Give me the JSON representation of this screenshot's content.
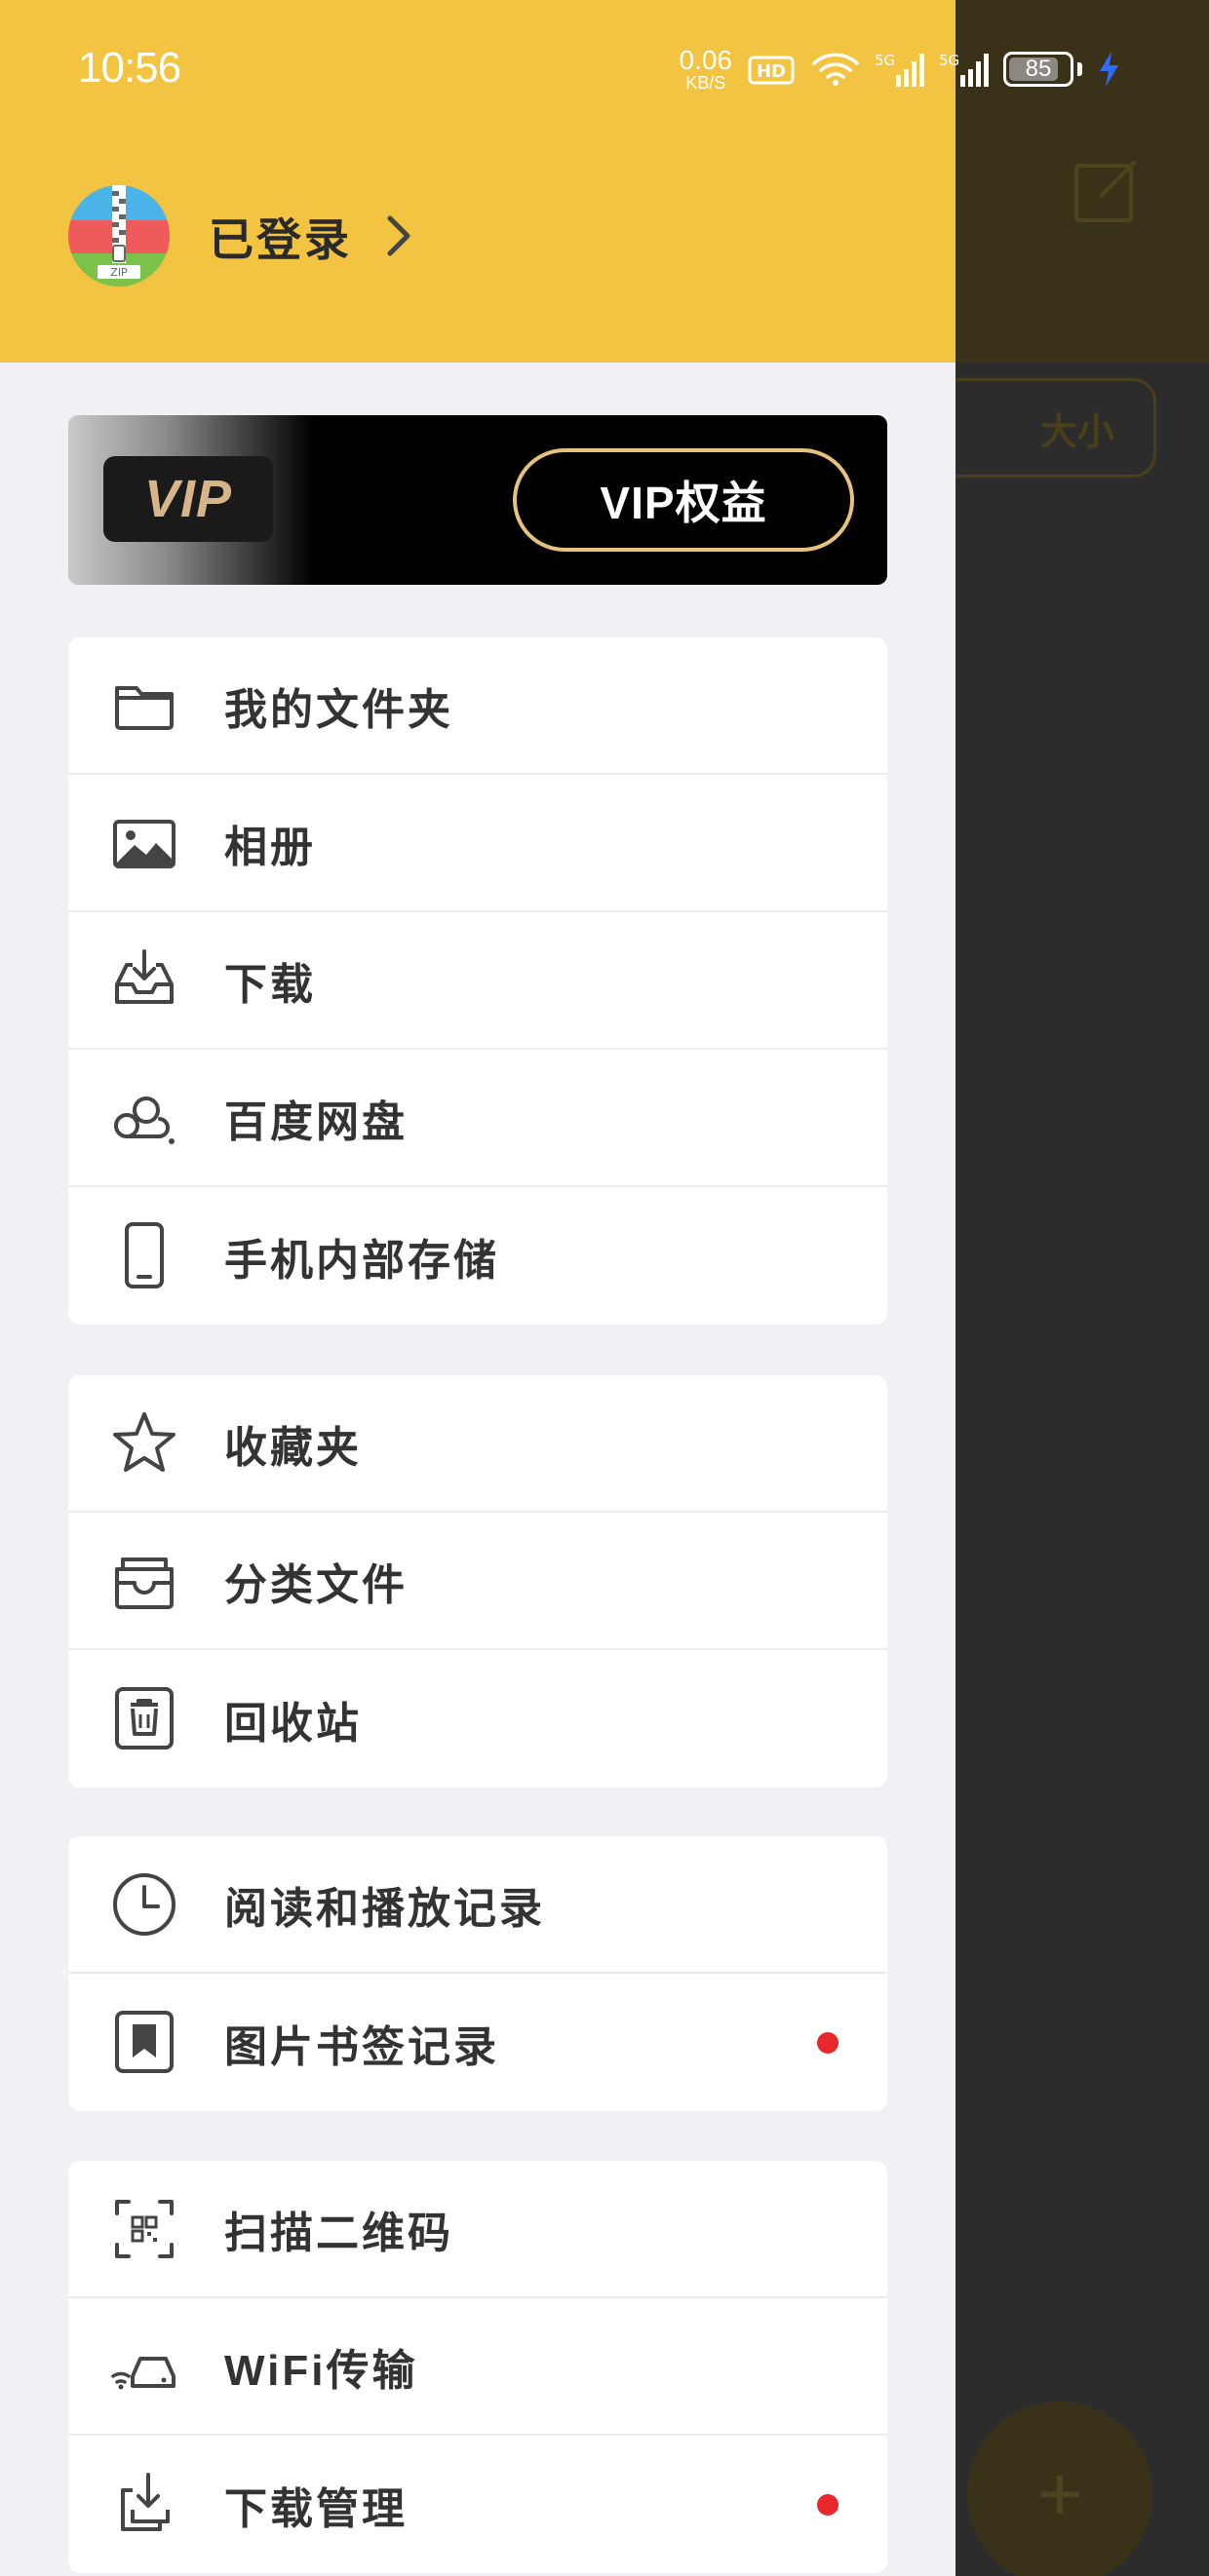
{
  "status_bar": {
    "time": "10:56",
    "net_speed_value": "0.06",
    "net_speed_unit": "KB/S",
    "hd_label": "HD",
    "signal1_label": "5G",
    "signal2_label": "5G",
    "battery_level": "85"
  },
  "background": {
    "sort_chip_label": "大小",
    "fab_label": "+"
  },
  "profile": {
    "name": "已登录",
    "avatar_text": "ZIP"
  },
  "vip": {
    "badge_label": "VIP",
    "button_label": "VIP权益"
  },
  "menu_groups": [
    {
      "items": [
        {
          "label": "我的文件夹",
          "icon": "folder-icon"
        },
        {
          "label": "相册",
          "icon": "image-icon"
        },
        {
          "label": "下载",
          "icon": "download-tray-icon"
        },
        {
          "label": "百度网盘",
          "icon": "baidu-cloud-icon"
        },
        {
          "label": "手机内部存储",
          "icon": "phone-icon"
        }
      ]
    },
    {
      "items": [
        {
          "label": "收藏夹",
          "icon": "star-icon"
        },
        {
          "label": "分类文件",
          "icon": "category-box-icon"
        },
        {
          "label": "回收站",
          "icon": "trash-icon"
        }
      ]
    },
    {
      "items": [
        {
          "label": "阅读和播放记录",
          "icon": "clock-icon"
        },
        {
          "label": "图片书签记录",
          "icon": "bookmark-icon",
          "badge": true
        }
      ]
    },
    {
      "items": [
        {
          "label": "扫描二维码",
          "icon": "qr-scan-icon"
        },
        {
          "label": "WiFi传输",
          "icon": "wifi-transfer-icon"
        },
        {
          "label": "下载管理",
          "icon": "download-manage-icon",
          "badge": true
        }
      ]
    }
  ],
  "colors": {
    "header_yellow": "#f2c442",
    "badge_red": "#e8282d",
    "vip_gold": "#e6c27c"
  }
}
